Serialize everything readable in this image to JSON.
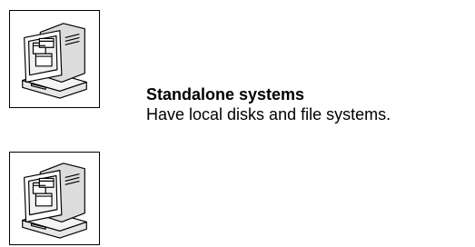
{
  "item": {
    "title": "Standalone systems",
    "description": "Have local disks and file systems.",
    "icon": "computer-workstation-icon"
  }
}
